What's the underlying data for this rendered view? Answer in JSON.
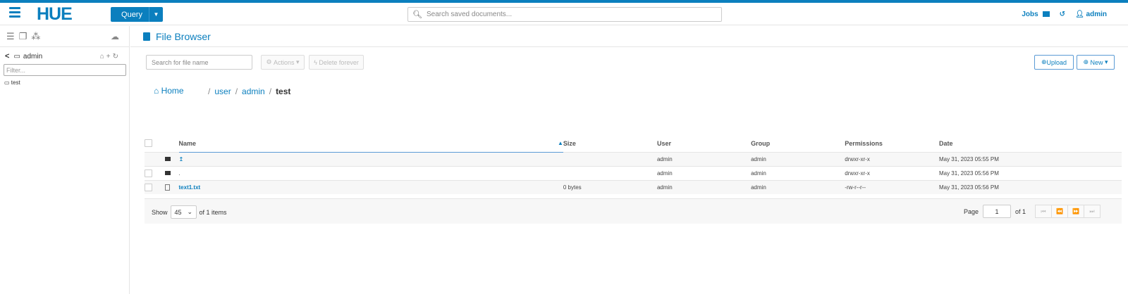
{
  "header": {
    "logo": "HUE",
    "query_label": "Query",
    "search_placeholder": "Search saved documents...",
    "jobs_label": "Jobs",
    "user_label": "admin"
  },
  "left_panel": {
    "current_dir": "admin",
    "filter_placeholder": "Filter...",
    "tree": [
      "test"
    ]
  },
  "main": {
    "title": "File Browser",
    "search_placeholder": "Search for file name",
    "actions_label": "Actions",
    "delete_label": "Delete forever",
    "upload_label": "Upload",
    "new_label": "New",
    "breadcrumb": {
      "home": "Home",
      "path": [
        "user",
        "admin"
      ],
      "current": "test"
    },
    "columns": [
      "Name",
      "Size",
      "User",
      "Group",
      "Permissions",
      "Date"
    ],
    "rows": [
      {
        "name": "↥",
        "size": "",
        "user": "admin",
        "group": "admin",
        "permissions": "drwxr-xr-x",
        "date": "May 31, 2023 05:55 PM"
      },
      {
        "name": ".",
        "size": "",
        "user": "admin",
        "group": "admin",
        "permissions": "drwxr-xr-x",
        "date": "May 31, 2023 05:56 PM"
      },
      {
        "name": "text1.txt",
        "size": "0 bytes",
        "user": "admin",
        "group": "admin",
        "permissions": "-rw-r--r--",
        "date": "May 31, 2023 05:56 PM"
      }
    ],
    "footer": {
      "show_label": "Show",
      "page_size": "45",
      "items_label": "of 1 items",
      "page_label": "Page",
      "page_value": "1",
      "page_total": "of 1"
    }
  }
}
